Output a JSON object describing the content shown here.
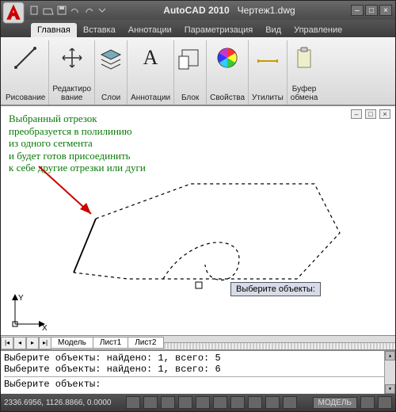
{
  "title": {
    "app": "AutoCAD 2010",
    "doc": "Чертеж1.dwg"
  },
  "tabs": {
    "home": "Главная",
    "insert": "Вставка",
    "annotate": "Аннотации",
    "parametric": "Параметризация",
    "view": "Вид",
    "manage": "Управление"
  },
  "panels": {
    "draw": "Рисование",
    "modify": "Редактиро\nвание",
    "layers": "Слои",
    "annotation": "Аннотации",
    "block": "Блок",
    "properties": "Свойства",
    "utilities": "Утилиты",
    "clipboard": "Буфер\nобмена"
  },
  "annotation_lines": [
    "Выбранный отрезок",
    "преобразуется в полилинию",
    "из одного сегмента",
    "и будет готов присоединить",
    "к себе другие отрезки или дуги"
  ],
  "prompt": "Выберите объекты:",
  "model_tabs": {
    "model": "Модель",
    "sheet1": "Лист1",
    "sheet2": "Лист2"
  },
  "cmd": {
    "l1": "Выберите объекты: найдено: 1, всего: 5",
    "l2": "Выберите объекты: найдено: 1, всего: 6",
    "l3": "Выберите объекты:"
  },
  "status": {
    "coords": "2336.6956, 1126.8866, 0.0000",
    "model": "МОДЕЛЬ"
  },
  "axis": {
    "x": "X",
    "y": "Y"
  }
}
